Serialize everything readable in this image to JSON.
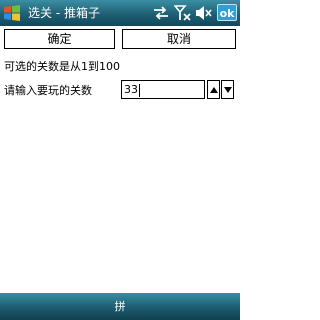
{
  "titlebar": {
    "title": "选关 - 推箱子",
    "ok_label": "ok"
  },
  "buttons": {
    "confirm_label": "确定",
    "cancel_label": "取消"
  },
  "level": {
    "range_text": "可选的关数是从1到100",
    "prompt_text": "请输入要玩的关数",
    "value": "33"
  },
  "softkeys": {
    "center_label": "拼"
  },
  "icons": [
    "windows-start-icon",
    "connectivity-icon",
    "signal-off-icon",
    "volume-icon",
    "spin-up-icon",
    "spin-down-icon"
  ],
  "colors": {
    "titlebar": "#1f5f73",
    "ok_button": "#2f9fd6"
  }
}
